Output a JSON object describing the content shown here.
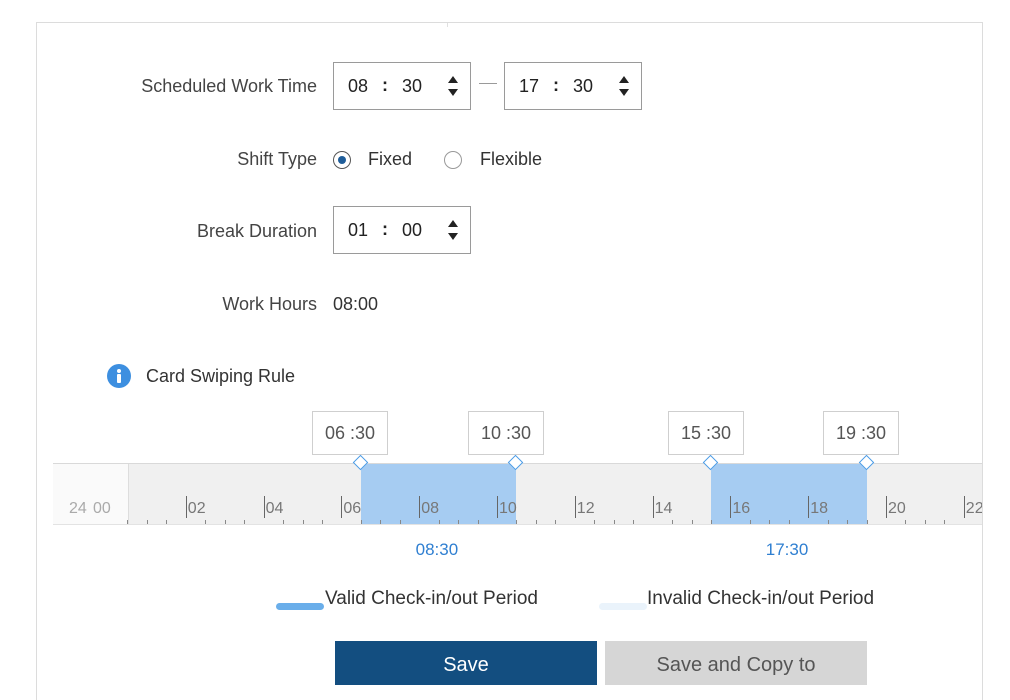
{
  "form": {
    "scheduled_work_time": {
      "label": "Scheduled Work Time",
      "start": {
        "hour": "08",
        "minute": "30"
      },
      "end": {
        "hour": "17",
        "minute": "30"
      }
    },
    "shift_type": {
      "label": "Shift Type",
      "options": [
        {
          "label": "Fixed",
          "selected": true
        },
        {
          "label": "Flexible",
          "selected": false
        }
      ]
    },
    "break_duration": {
      "label": "Break Duration",
      "hour": "01",
      "minute": "00"
    },
    "work_hours": {
      "label": "Work Hours",
      "value": "08:00"
    }
  },
  "card_rule": {
    "title": "Card Swiping Rule",
    "tooltips": [
      "06 :30",
      "10 :30",
      "15 :30",
      "19 :30"
    ],
    "periods": [
      {
        "start": 6.5,
        "end": 10.5
      },
      {
        "start": 15.5,
        "end": 19.5
      }
    ],
    "axis": {
      "lead_label": "24",
      "start_label": "00",
      "ticks": [
        "02",
        "04",
        "06",
        "08",
        "10",
        "12",
        "14",
        "16",
        "18",
        "20",
        "22"
      ]
    },
    "work_markers": [
      {
        "label": "08:30",
        "hour": 8.5
      },
      {
        "label": "17:30",
        "hour": 17.5
      }
    ]
  },
  "legend": {
    "valid": "Valid Check-in/out Period",
    "invalid": "Invalid Check-in/out Period",
    "valid_color": "#6aaeea",
    "invalid_color": "#eaf3fb"
  },
  "buttons": {
    "save": "Save",
    "save_copy": "Save and Copy to"
  }
}
